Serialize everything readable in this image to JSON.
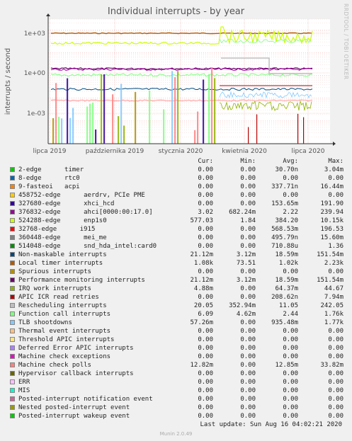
{
  "chart_data": {
    "type": "line",
    "title": "Individual interrupts - by year",
    "ylabel": "interrupts / second",
    "side_label": "RRDTOOL / TOBI OETIKER",
    "y_scale": "log",
    "ylim": [
      0.0001,
      30
    ],
    "y_ticks": [
      "1e+03",
      "1e+00",
      "1e-03"
    ],
    "x_ticks": [
      "lipca 2019",
      "października 2019",
      "stycznia 2020",
      "kwietnia 2020",
      "lipca 2020"
    ],
    "grid": true,
    "columns": [
      "Cur:",
      "Min:",
      "Avg:",
      "Max:"
    ],
    "series": [
      {
        "name": "2-edge      timer",
        "color": "#00cc00",
        "cur": "0.00",
        "min": "0.00",
        "avg": "30.70n",
        "max": "3.04m"
      },
      {
        "name": "8-edge      rtc0",
        "color": "#0066b3",
        "cur": "0.00",
        "min": "0.00",
        "avg": "0.00",
        "max": "0.00"
      },
      {
        "name": "9-fasteoi   acpi",
        "color": "#ff8000",
        "cur": "0.00",
        "min": "0.00",
        "avg": "337.71n",
        "max": "16.44m"
      },
      {
        "name": "458752-edge      aerdrv, PCIe PME",
        "color": "#ffcc00",
        "cur": "0.00",
        "min": "0.00",
        "avg": "0.00",
        "max": "0.00"
      },
      {
        "name": "327680-edge      xhci_hcd",
        "color": "#330099",
        "cur": "0.00",
        "min": "0.00",
        "avg": "153.65m",
        "max": "191.90"
      },
      {
        "name": "376832-edge      ahci[0000:00:17.0]",
        "color": "#990099",
        "cur": "3.02",
        "min": "682.24m",
        "avg": "2.22",
        "max": "239.94"
      },
      {
        "name": "524288-edge      enp1s0",
        "color": "#ccff00",
        "cur": "577.03",
        "min": "1.84",
        "avg": "384.20",
        "max": "10.15k"
      },
      {
        "name": "32768-edge      i915",
        "color": "#ff0000",
        "cur": "0.00",
        "min": "0.00",
        "avg": "568.53m",
        "max": "196.53"
      },
      {
        "name": "360448-edge      mei_me",
        "color": "#808080",
        "cur": "0.00",
        "min": "0.00",
        "avg": "495.79n",
        "max": "15.60m"
      },
      {
        "name": "514048-edge      snd_hda_intel:card0",
        "color": "#008f00",
        "cur": "0.00",
        "min": "0.00",
        "avg": "710.88u",
        "max": "1.36"
      },
      {
        "name": "Non-maskable interrupts",
        "color": "#00487d",
        "cur": "21.12m",
        "min": "3.12m",
        "avg": "18.59m",
        "max": "151.54m"
      },
      {
        "name": "Local timer interrupts",
        "color": "#b35a00",
        "cur": "1.08k",
        "min": "73.51",
        "avg": "1.02k",
        "max": "2.23k"
      },
      {
        "name": "Spurious interrupts",
        "color": "#b38f00",
        "cur": "0.00",
        "min": "0.00",
        "avg": "0.00",
        "max": "0.00"
      },
      {
        "name": "Performance monitoring interrupts",
        "color": "#6b006b",
        "cur": "21.12m",
        "min": "3.12m",
        "avg": "18.59m",
        "max": "151.54m"
      },
      {
        "name": "IRQ work interrupts",
        "color": "#8fb300",
        "cur": "4.88m",
        "min": "0.00",
        "avg": "64.37m",
        "max": "44.67"
      },
      {
        "name": "APIC ICR read retries",
        "color": "#b30000",
        "cur": "0.00",
        "min": "0.00",
        "avg": "208.62n",
        "max": "7.94m"
      },
      {
        "name": "Rescheduling interrupts",
        "color": "#bebebe",
        "cur": "20.05",
        "min": "352.94m",
        "avg": "11.05",
        "max": "242.05"
      },
      {
        "name": "Function call interrupts",
        "color": "#80ff80",
        "cur": "6.09",
        "min": "4.62m",
        "avg": "2.44",
        "max": "1.76k"
      },
      {
        "name": "TLB shootdowns",
        "color": "#80c9ff",
        "cur": "57.26m",
        "min": "0.00",
        "avg": "935.48m",
        "max": "1.77k"
      },
      {
        "name": "Thermal event interrupts",
        "color": "#ffc080",
        "cur": "0.00",
        "min": "0.00",
        "avg": "0.00",
        "max": "0.00"
      },
      {
        "name": "Threshold APIC interrupts",
        "color": "#ffe680",
        "cur": "0.00",
        "min": "0.00",
        "avg": "0.00",
        "max": "0.00"
      },
      {
        "name": "Deferred Error APIC interrupts",
        "color": "#aa80ff",
        "cur": "0.00",
        "min": "0.00",
        "avg": "0.00",
        "max": "0.00"
      },
      {
        "name": "Machine check exceptions",
        "color": "#ee00cc",
        "cur": "0.00",
        "min": "0.00",
        "avg": "0.00",
        "max": "0.00"
      },
      {
        "name": "Machine check polls",
        "color": "#ff8080",
        "cur": "12.82m",
        "min": "0.00",
        "avg": "12.85m",
        "max": "33.82m"
      },
      {
        "name": "Hypervisor callback interrupts",
        "color": "#666600",
        "cur": "0.00",
        "min": "0.00",
        "avg": "0.00",
        "max": "0.00"
      },
      {
        "name": "ERR",
        "color": "#ffbfff",
        "cur": "0.00",
        "min": "0.00",
        "avg": "0.00",
        "max": "0.00"
      },
      {
        "name": "MIS",
        "color": "#00ffcc",
        "cur": "0.00",
        "min": "0.00",
        "avg": "0.00",
        "max": "0.00"
      },
      {
        "name": "Posted-interrupt notification event",
        "color": "#cc6699",
        "cur": "0.00",
        "min": "0.00",
        "avg": "0.00",
        "max": "0.00"
      },
      {
        "name": "Nested posted-interrupt event",
        "color": "#999900",
        "cur": "0.00",
        "min": "0.00",
        "avg": "0.00",
        "max": "0.00"
      },
      {
        "name": "Posted-interrupt wakeup event",
        "color": "#00cc00",
        "cur": "0.00",
        "min": "0.00",
        "avg": "0.00",
        "max": "0.00"
      }
    ]
  },
  "footer": {
    "last_update": "Last update: Sun Aug 16 04:02:21 2020",
    "munin": "Munin 2.0.49"
  }
}
